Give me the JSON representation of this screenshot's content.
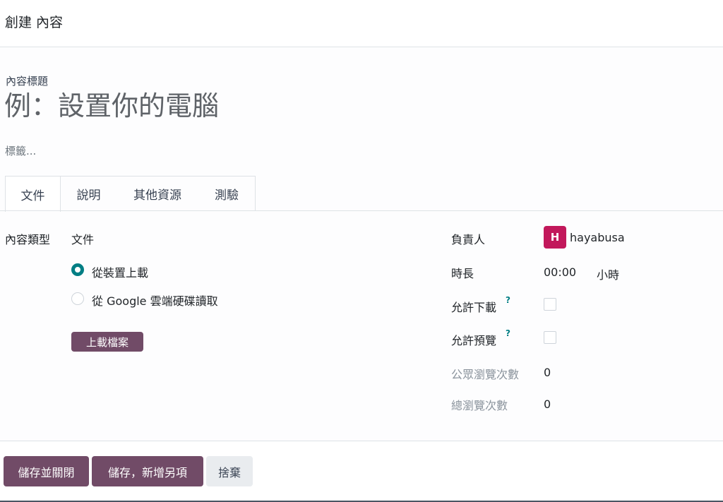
{
  "dialog": {
    "title": "創建 內容"
  },
  "form": {
    "title_label": "內容標題",
    "title_placeholder": "例：設置你的電腦",
    "tags_placeholder": "標籤..."
  },
  "tabs": [
    {
      "label": "文件",
      "active": true
    },
    {
      "label": "說明",
      "active": false
    },
    {
      "label": "其他資源",
      "active": false
    },
    {
      "label": "測驗",
      "active": false
    }
  ],
  "left": {
    "content_type_label": "內容類型",
    "content_type_value": "文件",
    "source_options": [
      {
        "label": "從裝置上載",
        "checked": true
      },
      {
        "label": "從 Google 雲端硬碟讀取",
        "checked": false
      }
    ],
    "upload_button": "上載檔案"
  },
  "right": {
    "responsible_label": "負責人",
    "responsible_avatar": "H",
    "responsible_name": "hayabusa",
    "duration_label": "時長",
    "duration_value": "00:00",
    "duration_unit": "小時",
    "allow_download_label": "允許下載",
    "allow_download_help": "?",
    "allow_download_checked": false,
    "allow_preview_label": "允許預覽",
    "allow_preview_help": "?",
    "allow_preview_checked": false,
    "public_views_label": "公眾瀏覽次數",
    "public_views_value": "0",
    "total_views_label": "總瀏覽次數",
    "total_views_value": "0"
  },
  "footer": {
    "save_close": "儲存並關閉",
    "save_new": "儲存，新增另項",
    "discard": "捨棄"
  },
  "colors": {
    "primary": "#714b67",
    "accent": "#017e84",
    "avatar": "#c2185b"
  }
}
